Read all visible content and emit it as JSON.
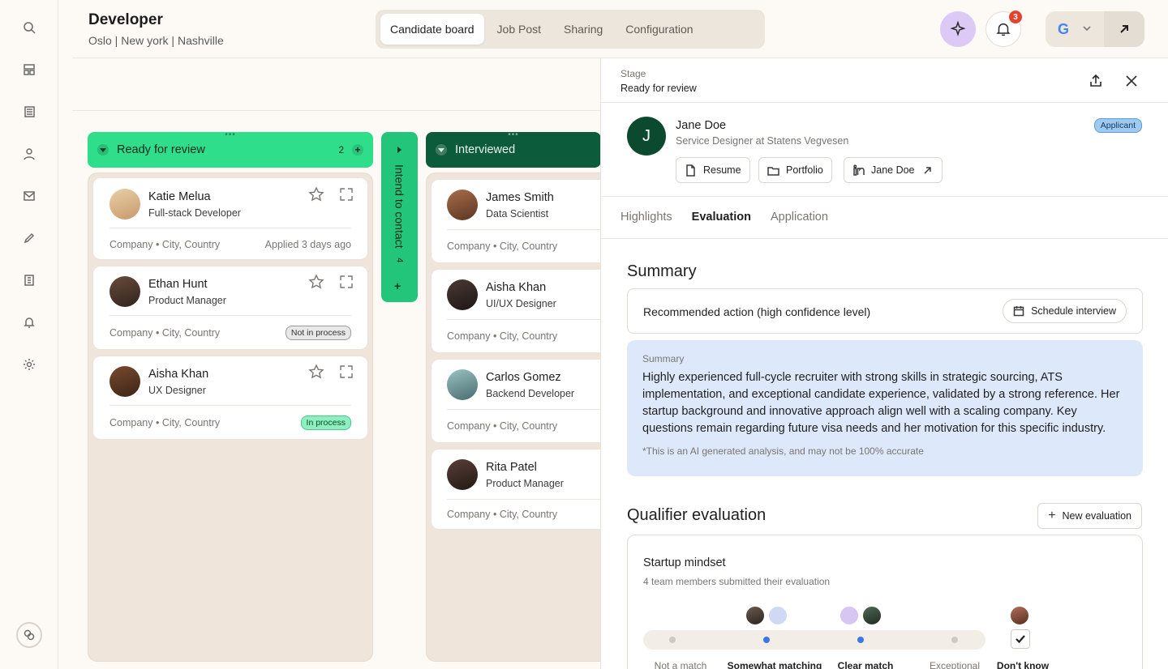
{
  "header": {
    "title": "Developer",
    "locations": "Oslo | New york | Nashville",
    "tabs": [
      {
        "label": "Candidate board",
        "active": true
      },
      {
        "label": "Job Post",
        "active": false
      },
      {
        "label": "Sharing",
        "active": false
      },
      {
        "label": "Configuration",
        "active": false
      }
    ],
    "notification_count": "3",
    "account_letter": "G"
  },
  "rail": {
    "icons": [
      "search-icon",
      "layout-icon",
      "list-icon",
      "user-icon",
      "mail-icon",
      "pen-icon",
      "building-icon",
      "bell-icon",
      "gear-icon"
    ]
  },
  "board": {
    "columns": [
      {
        "name": "Ready for review",
        "count": "2",
        "color": "#2fde8a"
      },
      {
        "name": "Intend to contact",
        "count": "4",
        "color": "#22c57a"
      },
      {
        "name": "Interviewed",
        "count": "",
        "color": "#0c5b3a"
      }
    ],
    "ready_cards": [
      {
        "name": "Katie Melua",
        "role": "Full-stack Developer",
        "meta": "Company  •  City, Country",
        "status": "Applied 3 days ago"
      },
      {
        "name": "Ethan Hunt",
        "role": "Product Manager",
        "meta": "Company  •  City, Country",
        "status": "Not in process"
      },
      {
        "name": "Aisha Khan",
        "role": "UX Designer",
        "meta": "Company  •  City, Country",
        "status": "In process"
      }
    ],
    "interviewed_cards": [
      {
        "name": "James Smith",
        "role": "Data Scientist",
        "meta": "Company  •  City, Country"
      },
      {
        "name": "Aisha Khan",
        "role": "UI/UX Designer",
        "meta": "Company  •  City, Country"
      },
      {
        "name": "Carlos Gomez",
        "role": "Backend Developer",
        "meta": "Company  •  City, Country"
      },
      {
        "name": "Rita Patel",
        "role": "Product Manager",
        "meta": "Company  •  City, Country"
      }
    ]
  },
  "drawer": {
    "stage_label": "Stage",
    "stage_value": "Ready for review",
    "candidate": {
      "initial": "J",
      "name": "Jane Doe",
      "role": "Service Designer at Statens Vegvesen",
      "badge": "Applicant"
    },
    "links": {
      "resume": "Resume",
      "portfolio": "Portfolio",
      "linkedin": "Jane Doe"
    },
    "tabs": [
      {
        "label": "Highlights",
        "active": false
      },
      {
        "label": "Evaluation",
        "active": true
      },
      {
        "label": "Application",
        "active": false
      }
    ],
    "summary_heading": "Summary",
    "recommended_action": "Recommended action (high confidence level)",
    "schedule_label": "Schedule interview",
    "summary_label": "Summary",
    "summary_text": "Highly experienced full-cycle recruiter with strong skills in strategic sourcing, ATS implementation, and exceptional candidate experience, validated by a strong reference. Her startup background and innovative approach align well with a scaling company. Key questions remain regarding future visa needs and her motivation for this specific industry.",
    "summary_note": "*This is an AI generated analysis, and may not be 100% accurate",
    "qualifier_heading": "Qualifier evaluation",
    "new_evaluation_label": "New evaluation",
    "qualifier": {
      "title": "Startup mindset",
      "subtitle": "4 team members submitted their evaluation",
      "scale": [
        "Not a match",
        "Somewhat matching",
        "Clear match",
        "Exceptional"
      ],
      "dont_know": "Don't know",
      "selected": [
        "Somewhat matching",
        "Clear match"
      ]
    }
  }
}
